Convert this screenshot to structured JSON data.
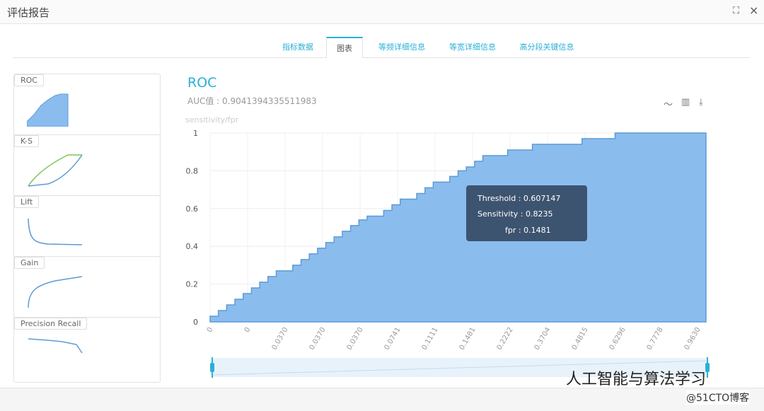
{
  "window": {
    "title": "评估报告",
    "expand_icon": "⛶",
    "close_icon": "×"
  },
  "tabs": [
    "指标数据",
    "图表",
    "等频详细信息",
    "等宽详细信息",
    "高分段关键信息"
  ],
  "active_tab": 1,
  "sidebar": [
    "ROC",
    "K-S",
    "Lift",
    "Gain",
    "Precision Recall"
  ],
  "chart_header": {
    "title": "ROC",
    "auc": "AUC值 : 0.9041394335511983",
    "ylabel": "sensitivity/fpr"
  },
  "toolbar": {
    "line_icon": "line-chart-icon",
    "bar_icon": "bar-chart-icon",
    "download_icon": "download-icon"
  },
  "tooltip": {
    "threshold": "Threshold : 0.607147",
    "sensitivity": "Sensitivity : 0.8235",
    "fpr": "fpr : 0.1481"
  },
  "watermark": {
    "text": "人工智能与算法学习",
    "source": "@51CTO博客"
  },
  "chart_data": {
    "type": "area",
    "title": "ROC",
    "ylabel": "sensitivity/fpr",
    "ylim": [
      0,
      1
    ],
    "yticks": [
      "0",
      "0.2",
      "0.4",
      "0.6",
      "0.8",
      "1"
    ],
    "xtick_labels": [
      "0",
      "0",
      "0.0370",
      "0.0370",
      "0.0370",
      "0.0741",
      "0.1111",
      "0.1481",
      "0.2222",
      "0.3704",
      "0.4815",
      "0.6296",
      "0.7778",
      "0.9630"
    ],
    "sensitivity": [
      0.03,
      0.06,
      0.09,
      0.12,
      0.15,
      0.18,
      0.21,
      0.24,
      0.27,
      0.27,
      0.3,
      0.33,
      0.36,
      0.39,
      0.42,
      0.45,
      0.48,
      0.51,
      0.54,
      0.56,
      0.56,
      0.59,
      0.62,
      0.65,
      0.65,
      0.68,
      0.71,
      0.74,
      0.74,
      0.77,
      0.8,
      0.82,
      0.85,
      0.88,
      0.88,
      0.88,
      0.91,
      0.91,
      0.91,
      0.94,
      0.94,
      0.94,
      0.94,
      0.94,
      0.94,
      0.97,
      0.97,
      0.97,
      0.97,
      1,
      1,
      1,
      1,
      1,
      1,
      1,
      1,
      1,
      1,
      1
    ],
    "color": "#8bbcee"
  }
}
